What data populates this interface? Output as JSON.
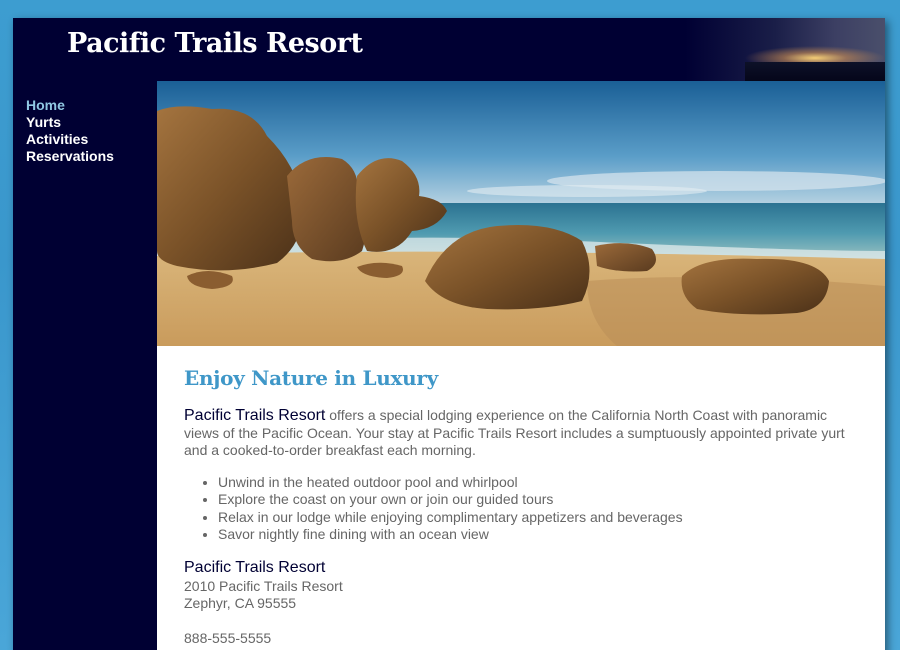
{
  "site": {
    "title": "Pacific Trails Resort"
  },
  "nav": {
    "items": [
      {
        "label": "Home",
        "current": true
      },
      {
        "label": "Yurts",
        "current": false
      },
      {
        "label": "Activities",
        "current": false
      },
      {
        "label": "Reservations",
        "current": false
      }
    ]
  },
  "main": {
    "heading": "Enjoy Nature in Luxury",
    "intro": {
      "brand": "Pacific Trails Resort",
      "text": " offers a special lodging experience on the California North Coast with panoramic views of the Pacific Ocean. Your stay at Pacific Trails Resort includes a sumptuously appointed private yurt and a cooked-to-order breakfast each morning."
    },
    "features": [
      "Unwind in the heated outdoor pool and whirlpool",
      "Explore the coast on your own or join our guided tours",
      "Relax in our lodge while enjoying complimentary appetizers and beverages",
      "Savor nightly fine dining with an ocean view"
    ],
    "address": {
      "name": "Pacific Trails Resort",
      "street": "2010 Pacific Trails Resort",
      "city": "Zephyr, CA 95555"
    },
    "phone": "888-555-5555"
  },
  "colors": {
    "page_background": "#3d9dd0",
    "header_background": "#000033",
    "nav_current": "#90c7e3",
    "heading": "#3f97c8",
    "body_text": "#666666"
  }
}
